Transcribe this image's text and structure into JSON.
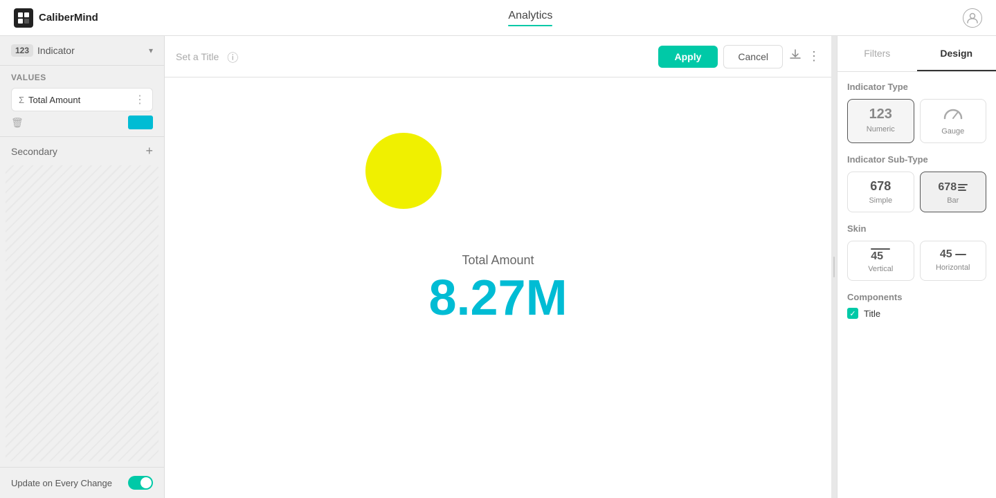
{
  "app": {
    "logo_text": "CaliberMind",
    "nav_title": "Analytics"
  },
  "header": {
    "set_title_placeholder": "Set a Title",
    "apply_label": "Apply",
    "cancel_label": "Cancel"
  },
  "sidebar": {
    "indicator_badge": "123",
    "indicator_label": "Indicator",
    "values_section_label": "Values",
    "total_amount_label": "Total Amount",
    "secondary_label": "Secondary",
    "footer_label": "Update on Every Change"
  },
  "chart": {
    "label": "Total Amount",
    "value": "8.27M"
  },
  "right_panel": {
    "tab_filters": "Filters",
    "tab_design": "Design",
    "indicator_type_title": "Indicator Type",
    "numeric_label": "Numeric",
    "gauge_label": "Gauge",
    "indicator_subtype_title": "Indicator Sub-Type",
    "simple_label": "Simple",
    "bar_label": "Bar",
    "skin_title": "Skin",
    "vertical_label": "Vertical",
    "horizontal_label": "Horizontal",
    "components_title": "Components",
    "title_component_label": "Title",
    "numeric_icon": "123",
    "simple_icon": "678",
    "bar_icon": "678"
  }
}
